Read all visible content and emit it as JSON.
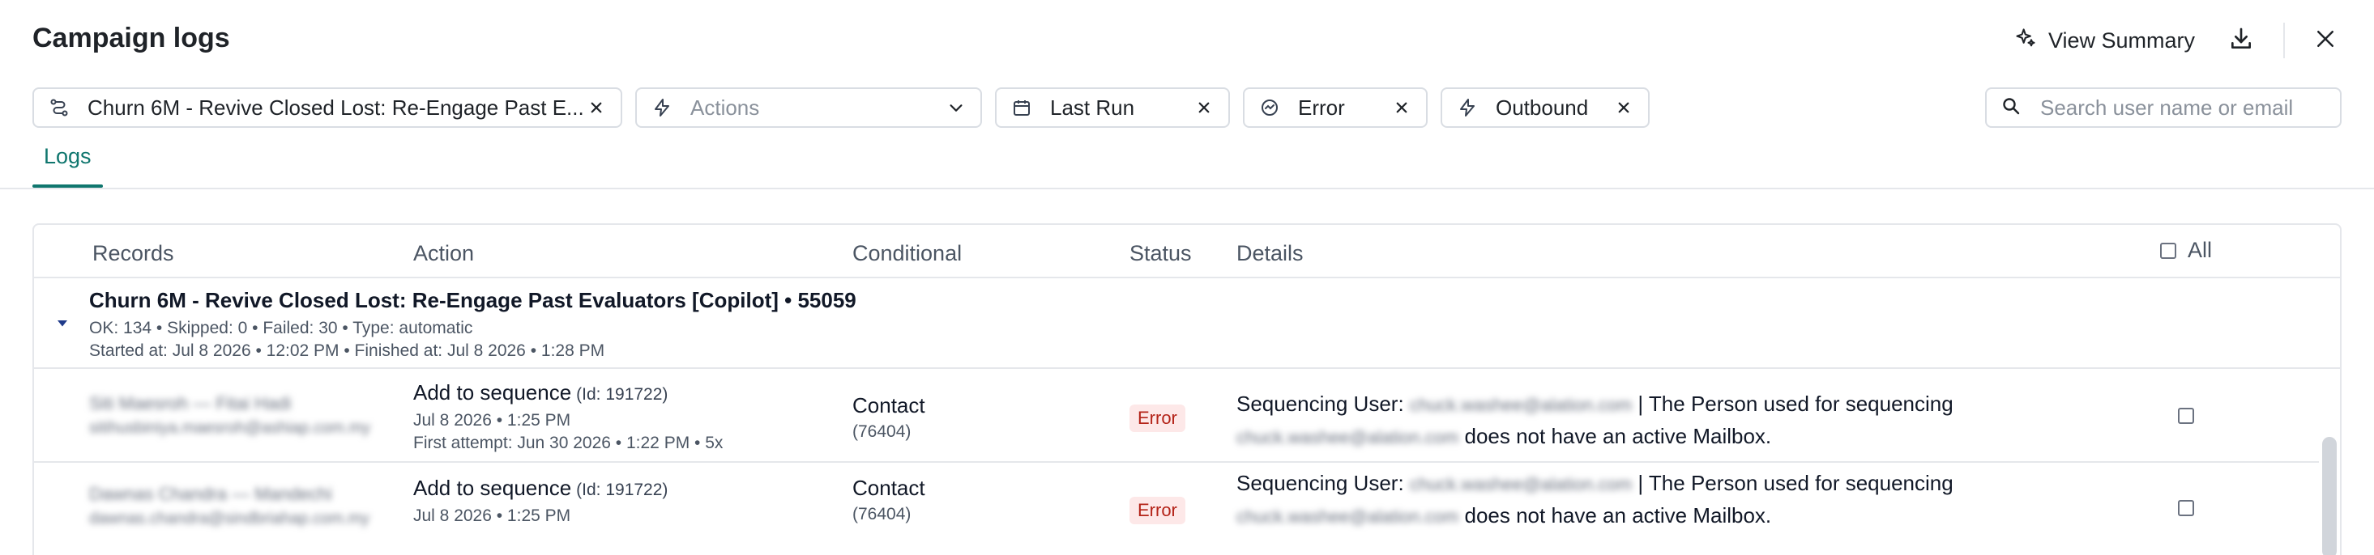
{
  "header": {
    "title": "Campaign logs",
    "view_summary_label": "View Summary"
  },
  "filters": {
    "campaign": "Churn 6M - Revive Closed Lost: Re-Engage Past E...",
    "actions_placeholder": "Actions",
    "run": "Last Run",
    "status": "Error",
    "direction": "Outbound",
    "search_placeholder": "Search user name or email"
  },
  "tabs": [
    {
      "label": "Logs"
    }
  ],
  "table": {
    "headers": {
      "records": "Records",
      "action": "Action",
      "conditional": "Conditional",
      "status": "Status",
      "details": "Details",
      "all": "All"
    },
    "group": {
      "title": "Churn 6M - Revive Closed Lost: Re-Engage Past Evaluators [Copilot] • 55059",
      "stats": "OK: 134 • Skipped: 0 • Failed: 30 • Type: automatic",
      "times": "Started at: Jul 8 2026 • 12:02 PM • Finished at: Jul 8 2026 • 1:28 PM"
    },
    "rows": [
      {
        "name": "Siti Maesroh — Fitai Hadi",
        "email": "sitihusbiniya.maesroh@ashiap.com.my",
        "action": "Add to sequence",
        "action_id": "(Id: 191722)",
        "date": "Jul 8 2026 • 1:25 PM",
        "first_attempt": "First attempt: Jun 30 2026 • 1:22 PM • 5x",
        "conditional": "Contact",
        "conditional_id": "(76404)",
        "status": "Error",
        "details_prefix": "Sequencing User:",
        "details_user": "chuck.washee@alation.com",
        "details_mid": "| The Person used for sequencing",
        "details_user2": "chuck.washee@alation.com",
        "details_suffix": "does not have an active Mailbox."
      },
      {
        "name": "Dawnas Chandra — Mandechi",
        "email": "dawnas.chandra@sindbriahap.com.my",
        "action": "Add to sequence",
        "action_id": "(Id: 191722)",
        "date": "Jul 8 2026 • 1:25 PM",
        "conditional": "Contact",
        "conditional_id": "(76404)",
        "status": "Error",
        "details_prefix": "Sequencing User:",
        "details_user": "chuck.washee@alation.com",
        "details_mid": "| The Person used for sequencing",
        "details_user2": "chuck.washee@alation.com",
        "details_suffix": "does not have an active Mailbox."
      }
    ]
  },
  "colors": {
    "accent": "#0f766e",
    "error_bg": "#fde8e8",
    "error_text": "#b42318",
    "border": "#d9dde3"
  },
  "icons": {
    "view_summary": "sparkles-icon",
    "download": "download-icon",
    "close": "close-icon",
    "campaign": "route-icon",
    "actions": "bolt-icon",
    "run": "calendar-icon",
    "status": "gauge-icon",
    "direction": "bolt-icon",
    "search": "search-icon",
    "expand": "caret-down-icon"
  }
}
